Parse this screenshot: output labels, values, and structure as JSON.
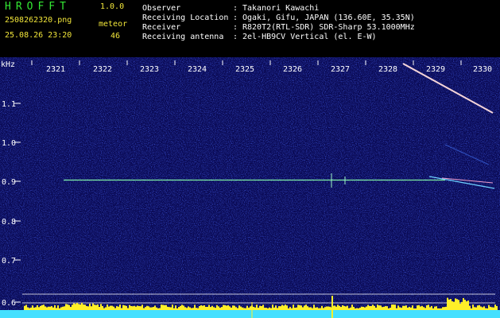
{
  "header": {
    "title": "HROFFT",
    "version": "1.0.0",
    "filename": "2508262320.png",
    "timestamp": "25.08.26 23:20",
    "meteor_label": "meteor",
    "meteor_count": "46",
    "info": [
      {
        "key": "Observer",
        "value": "Takanori Kawachi"
      },
      {
        "key": "Receiving Location",
        "value": "Ogaki, Gifu, JAPAN (136.60E, 35.35N)"
      },
      {
        "key": "Receiver",
        "value": "R820T2(RTL-SDR) SDR-Sharp 53.1000MHz"
      },
      {
        "key": "Receiving antenna",
        "value": "2el-HB9CV Vertical (el. E-W)"
      }
    ]
  },
  "plot": {
    "unit": "kHz",
    "time_labels": [
      "2321",
      "2322",
      "2323",
      "2324",
      "2325",
      "2326",
      "2327",
      "2328",
      "2329",
      "2330"
    ],
    "freq_labels": [
      "1.1",
      "1.0",
      "0.9",
      "0.8",
      "0.7",
      "0.6"
    ],
    "freq_values": [
      1.1,
      1.0,
      0.9,
      0.8,
      0.7,
      0.6
    ],
    "colors": {
      "background": "#0a0a55",
      "carrier": "#7ff0a8",
      "meteor_trail": "#f4d4d8",
      "baseline": "#44e0ff",
      "peaks": "#ffef28",
      "guide": "#ffffff"
    }
  }
}
